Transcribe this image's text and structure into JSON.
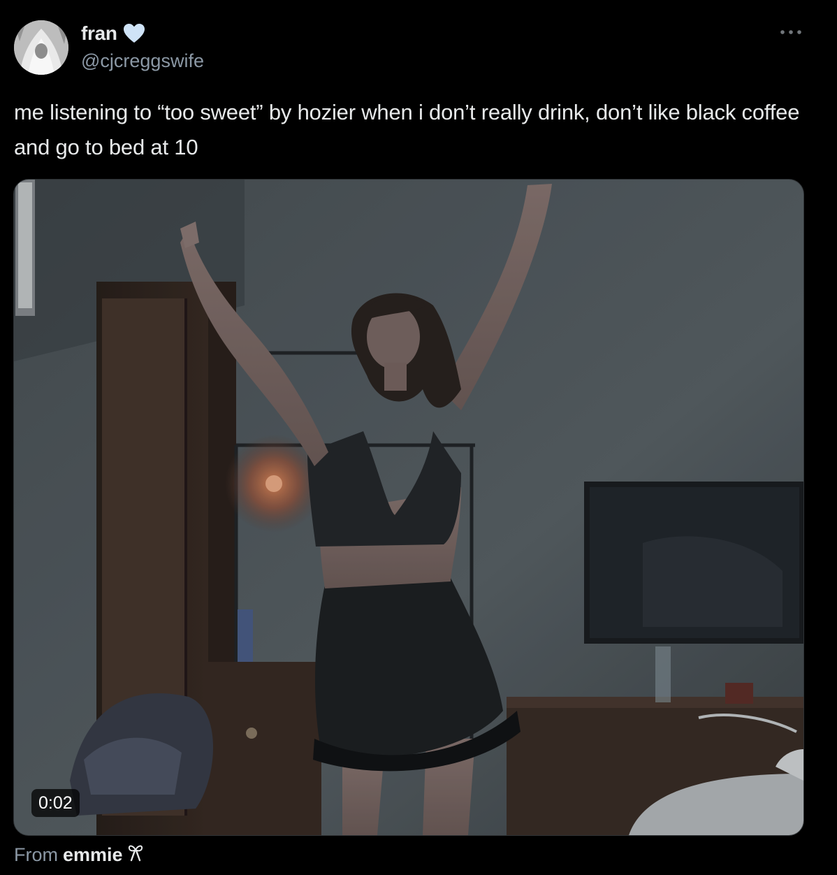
{
  "author": {
    "display_name": "fran",
    "name_emoji": "heart-icon",
    "handle": "@cjcreggswife",
    "avatar": "avatar-photo"
  },
  "tweet": {
    "text": "me listening to “too sweet” by hozier when i don’t really drink, don’t like black coffee and go to bed at 10",
    "more_icon": "more-dots-icon"
  },
  "media": {
    "type": "video",
    "duration": "0:02"
  },
  "attribution": {
    "prefix": "From",
    "source_name": "emmie",
    "source_emoji": "bow-icon"
  },
  "colors": {
    "background": "#000000",
    "primary_text": "#e7e9ea",
    "secondary_text": "#8b98a5",
    "heart": "#cfe3f7"
  }
}
